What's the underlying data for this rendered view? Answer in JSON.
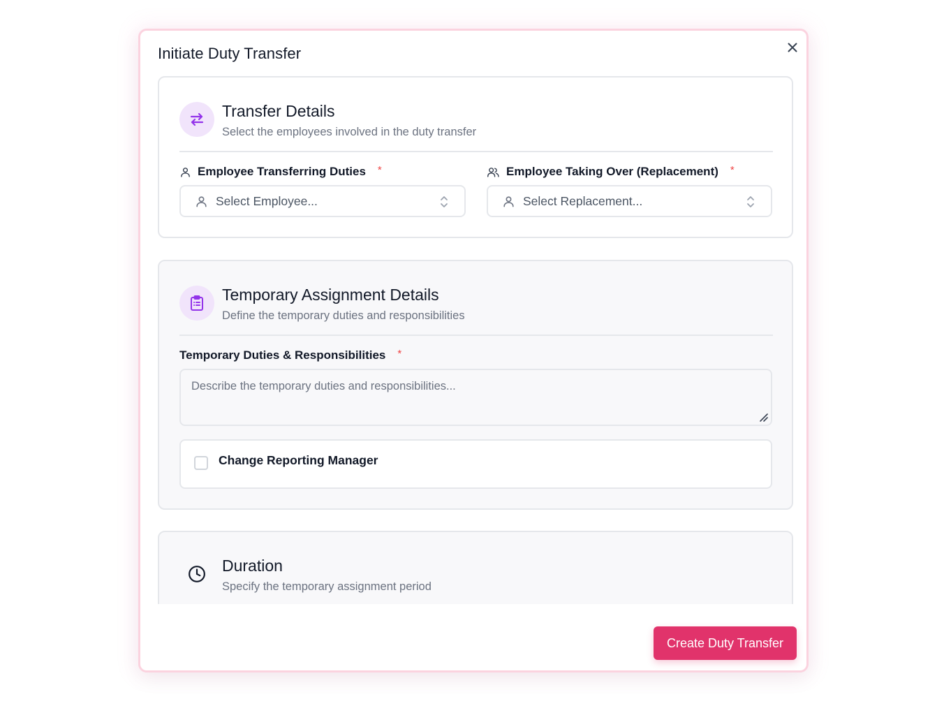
{
  "modal": {
    "title": "Initiate Duty Transfer",
    "close_icon": "close-icon"
  },
  "transfer_details": {
    "icon": "swap-arrows-icon",
    "title": "Transfer Details",
    "subtitle": "Select the employees involved in the duty transfer",
    "employee_field": {
      "label": "Employee Transferring Duties",
      "required_mark": "*",
      "placeholder": "Select Employee..."
    },
    "replacement_field": {
      "label": "Employee Taking Over (Replacement)",
      "required_mark": "*",
      "placeholder": "Select Replacement..."
    }
  },
  "temporary_assignment": {
    "icon": "clipboard-list-icon",
    "title": "Temporary Assignment Details",
    "subtitle": "Define the temporary duties and responsibilities",
    "duties_field": {
      "label": "Temporary Duties & Responsibilities",
      "required_mark": "*",
      "placeholder": "Describe the temporary duties and responsibilities..."
    },
    "change_manager": {
      "label": "Change Reporting Manager",
      "checked": false
    }
  },
  "duration": {
    "icon": "clock-icon",
    "title": "Duration",
    "subtitle": "Specify the temporary assignment period"
  },
  "footer": {
    "submit_label": "Create Duty Transfer"
  },
  "colors": {
    "accent": "#e1336b",
    "icon_purple": "#9333ea",
    "icon_bg": "#f1e4fb",
    "required": "#ef4444"
  }
}
